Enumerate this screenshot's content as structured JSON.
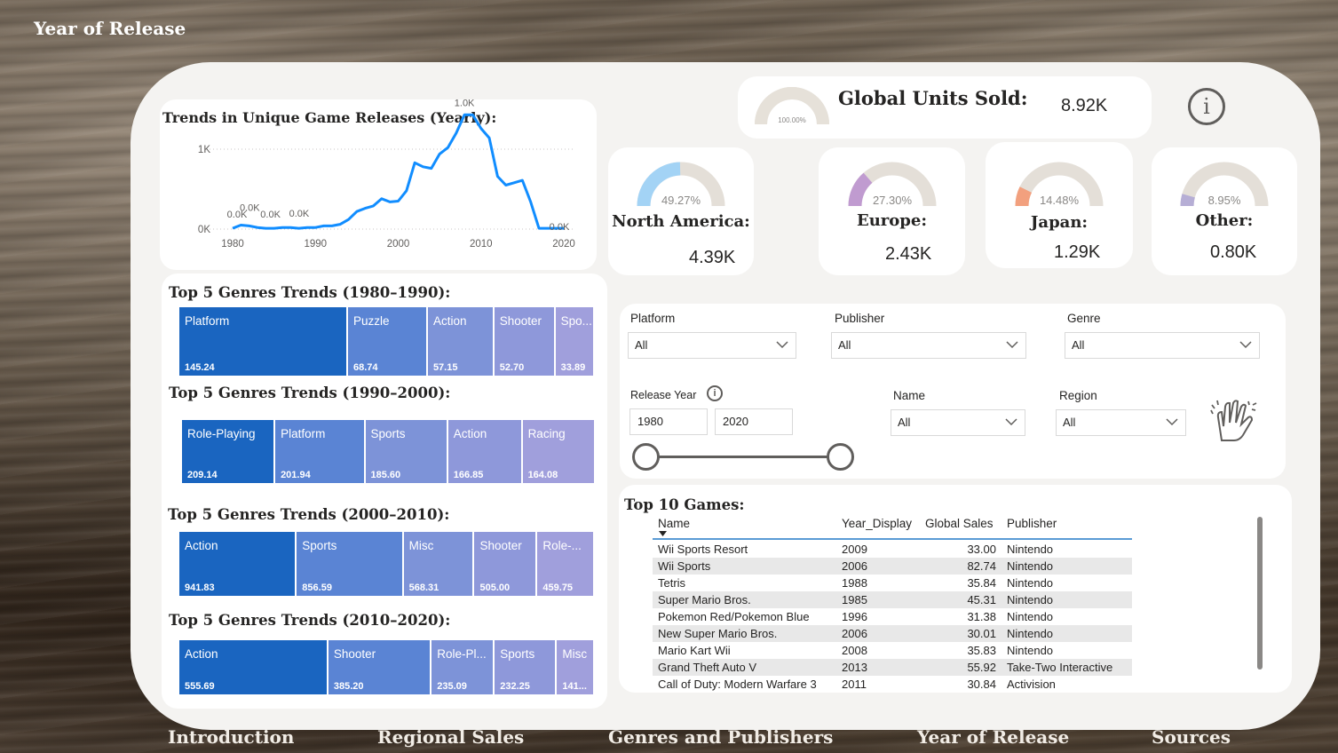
{
  "page": {
    "title": "Year of Release"
  },
  "line_chart": {
    "title": "Trends in Unique Game Releases (Yearly):",
    "chart_data": {
      "type": "line",
      "title": "Trends in Unique Game Releases (Yearly):",
      "xlabel": "",
      "ylabel": "",
      "x_ticks": [
        "1980",
        "1990",
        "2000",
        "2010",
        "2020"
      ],
      "y_ticks": [
        "0K",
        "1K"
      ],
      "xlim": [
        1980,
        2020
      ],
      "ylim": [
        0,
        1.4
      ],
      "series": [
        {
          "x": [
            1980,
            1981,
            1982,
            1983,
            1984,
            1985,
            1986,
            1987,
            1988,
            1989,
            1990,
            1991,
            1992,
            1993,
            1994,
            1995,
            1996,
            1997,
            1998,
            1999,
            2000,
            2001,
            2002,
            2003,
            2004,
            2005,
            2006,
            2007,
            2008,
            2009,
            2010,
            2011,
            2012,
            2013,
            2014,
            2015,
            2016,
            2017,
            2018,
            2019,
            2020
          ],
          "y": [
            0.01,
            0.05,
            0.04,
            0.02,
            0.01,
            0.01,
            0.02,
            0.02,
            0.01,
            0.02,
            0.02,
            0.04,
            0.04,
            0.06,
            0.12,
            0.22,
            0.26,
            0.29,
            0.38,
            0.34,
            0.35,
            0.48,
            0.83,
            0.78,
            0.76,
            0.94,
            1.02,
            1.2,
            1.43,
            1.43,
            1.26,
            1.14,
            0.66,
            0.55,
            0.58,
            0.61,
            0.34,
            0.01,
            0.01,
            0.01,
            0.01
          ]
        }
      ],
      "data_labels": [
        {
          "text": "0.0K",
          "x": 1980
        },
        {
          "text": "0.0K",
          "x": 1981
        },
        {
          "text": "0.0K",
          "x": 1985
        },
        {
          "text": "0.0K",
          "x": 1989
        },
        {
          "text": "1.0K",
          "x": 2008
        },
        {
          "text": "0.0K",
          "x": 2020
        }
      ],
      "color": "#118dff"
    }
  },
  "treemaps": [
    {
      "title": "Top 5 Genres Trends (1980–1990):",
      "chart_data": {
        "type": "treemap",
        "categories": [
          "Platform",
          "Puzzle",
          "Action",
          "Shooter",
          "Spo..."
        ],
        "values": [
          145.24,
          68.74,
          57.15,
          52.7,
          33.89
        ]
      },
      "value_labels": [
        "145.24",
        "68.74",
        "57.15",
        "52.70",
        "33.89"
      ]
    },
    {
      "title": "Top 5 Genres Trends (1990–2000):",
      "chart_data": {
        "type": "treemap",
        "categories": [
          "Role-Playing",
          "Platform",
          "Sports",
          "Action",
          "Racing"
        ],
        "values": [
          209.14,
          201.94,
          185.6,
          166.85,
          164.08
        ]
      },
      "value_labels": [
        "209.14",
        "201.94",
        "185.60",
        "166.85",
        "164.08"
      ]
    },
    {
      "title": "Top 5 Genres Trends (2000–2010):",
      "chart_data": {
        "type": "treemap",
        "categories": [
          "Action",
          "Sports",
          "Misc",
          "Shooter",
          "Role-..."
        ],
        "values": [
          941.83,
          856.59,
          568.31,
          505.0,
          459.75
        ]
      },
      "value_labels": [
        "941.83",
        "856.59",
        "568.31",
        "505.00",
        "459.75"
      ]
    },
    {
      "title": "Top 5 Genres Trends (2010–2020):",
      "chart_data": {
        "type": "treemap",
        "categories": [
          "Action",
          "Shooter",
          "Role-Pl...",
          "Sports",
          "Misc"
        ],
        "values": [
          555.69,
          385.2,
          235.09,
          232.25,
          141.0
        ]
      },
      "value_labels": [
        "555.69",
        "385.20",
        "235.09",
        "232.25",
        "141..."
      ]
    }
  ],
  "treemap_colors": [
    "#1a65c0",
    "#5a84d4",
    "#7d93d8",
    "#8e98da",
    "#a09fdc"
  ],
  "global": {
    "label": "Global Units Sold:",
    "value": "8.92K",
    "gauge_pct_text": "100.00%",
    "gauge_fraction": 1.0,
    "color": "#e6e1d9"
  },
  "regions": [
    {
      "name": "North America:",
      "value": "4.39K",
      "pct_text": "49.27%",
      "fraction": 0.4927,
      "color": "#a3d3f5"
    },
    {
      "name": "Europe:",
      "value": "2.43K",
      "pct_text": "27.30%",
      "fraction": 0.273,
      "color": "#c09bd0"
    },
    {
      "name": "Japan:",
      "value": "1.29K",
      "pct_text": "14.48%",
      "fraction": 0.1448,
      "color": "#f2a07e"
    },
    {
      "name": "Other:",
      "value": "0.80K",
      "pct_text": "8.95%",
      "fraction": 0.0895,
      "color": "#b6aed5"
    }
  ],
  "gauge_track_color": "#e4dfd8",
  "info_icon_glyph": "i",
  "filters": {
    "platform": {
      "label": "Platform",
      "value": "All"
    },
    "publisher": {
      "label": "Publisher",
      "value": "All"
    },
    "genre": {
      "label": "Genre",
      "value": "All"
    },
    "release_year": {
      "label": "Release Year",
      "start": "1980",
      "end": "2020",
      "info_glyph": "i"
    },
    "name": {
      "label": "Name",
      "value": "All"
    },
    "region": {
      "label": "Region",
      "value": "All"
    }
  },
  "table": {
    "title": "Top 10 Games:",
    "columns": [
      "Name",
      "Year_Display",
      "Global Sales",
      "Publisher"
    ],
    "rows": [
      [
        "Wii Sports Resort",
        "2009",
        "33.00",
        "Nintendo"
      ],
      [
        "Wii Sports",
        "2006",
        "82.74",
        "Nintendo"
      ],
      [
        "Tetris",
        "1988",
        "35.84",
        "Nintendo"
      ],
      [
        "Super Mario Bros.",
        "1985",
        "45.31",
        "Nintendo"
      ],
      [
        "Pokemon Red/Pokemon Blue",
        "1996",
        "31.38",
        "Nintendo"
      ],
      [
        "New Super Mario Bros.",
        "2006",
        "30.01",
        "Nintendo"
      ],
      [
        "Mario Kart Wii",
        "2008",
        "35.83",
        "Nintendo"
      ],
      [
        "Grand Theft Auto V",
        "2013",
        "55.92",
        "Take-Two Interactive"
      ],
      [
        "Call of Duty: Modern Warfare 3",
        "2011",
        "30.84",
        "Activision"
      ]
    ]
  },
  "nav": [
    "Introduction",
    "Regional Sales",
    "Genres and Publishers",
    "Year of Release",
    "Sources"
  ]
}
